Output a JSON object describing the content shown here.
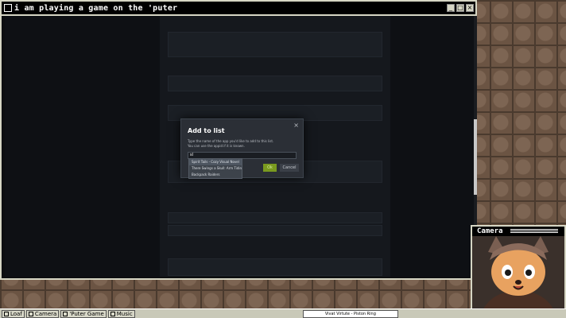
{
  "window": {
    "title": "i am playing a game on the 'puter"
  },
  "dialog": {
    "title": "Add to list",
    "close": "×",
    "description_1": "Type the name of the app you'd like to add to this list.",
    "description_2": "You can use the appid if it is known.",
    "input_value": "sl",
    "ok_label": "Ok",
    "cancel_label": "Cancel"
  },
  "suggestions": [
    "Spirit Tails - Cozy Visual Novel",
    "There Swings a Skull: Arm Tidings",
    "Backpack Raiders"
  ],
  "camera": {
    "title": "Camera"
  },
  "taskbar": {
    "items": [
      {
        "label": "Loaf",
        "icon": "folder-icon"
      },
      {
        "label": "Camera",
        "icon": "camera-icon"
      },
      {
        "label": "'Puter Game",
        "icon": "computer-icon"
      },
      {
        "label": "Music",
        "icon": "music-icon"
      }
    ],
    "now_playing": "Vivat Virtute - Piston Ring"
  }
}
